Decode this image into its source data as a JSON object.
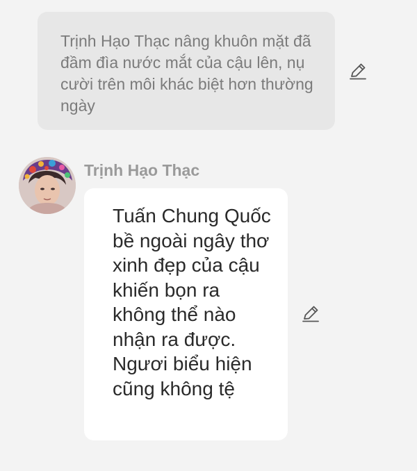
{
  "narration": {
    "text": "Trịnh Hạo Thạc nâng khuôn mặt đã đầm đìa nước mắt của cậu lên, nụ cười trên môi khác biệt hơn thường ngày",
    "edit_icon": "pencil-icon"
  },
  "message": {
    "sender": "Trịnh Hạo Thạc",
    "text": "Tuấn Chung Quốc bề ngoài ngây thơ xinh đẹp của cậu khiến bọn ra không thể nào nhận ra được. Ngươi biểu hiện cũng không tệ",
    "edit_icon": "pencil-icon"
  },
  "colors": {
    "background": "#f3f3f3",
    "narration_bubble": "#e7e7e7",
    "message_bubble": "#ffffff",
    "narration_text": "#7b7b7b",
    "sender_name": "#9a9a9a",
    "message_text": "#2a2a2a"
  }
}
